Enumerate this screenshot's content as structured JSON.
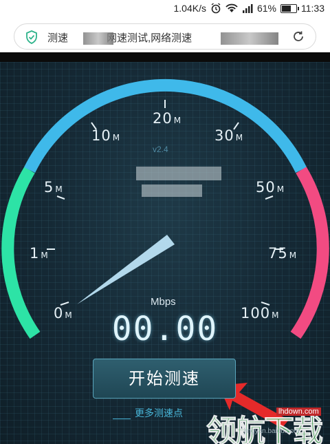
{
  "status_bar": {
    "network_speed": "1.04K/s",
    "battery_percent": "61%",
    "battery_level": 0.61,
    "time": "11:33"
  },
  "browser": {
    "url_prefix": "测速",
    "url_text": "网速测试,网络测速",
    "icons": [
      "shield-check-icon",
      "reload-icon"
    ]
  },
  "speed_test": {
    "version": "v2.4",
    "tick_labels": [
      {
        "value": "0",
        "unit": "M"
      },
      {
        "value": "1",
        "unit": "M"
      },
      {
        "value": "5",
        "unit": "M"
      },
      {
        "value": "10",
        "unit": "M"
      },
      {
        "value": "20",
        "unit": "M"
      },
      {
        "value": "30",
        "unit": "M"
      },
      {
        "value": "50",
        "unit": "M"
      },
      {
        "value": "75",
        "unit": "M"
      },
      {
        "value": "100",
        "unit": "M"
      }
    ],
    "unit_label": "Mbps",
    "speed_value": "00.00",
    "start_button_label": "开始测速",
    "more_points_label": "更多测速点",
    "colors": {
      "arc_low": "#2de3a6",
      "arc_mid": "#3fb9ea",
      "arc_high": "#f24b82",
      "needle": "#bfe6fa",
      "arrow": "#e52a2a"
    }
  },
  "watermark": {
    "site": "lhdown.com",
    "text": "领航下载",
    "sub": "jingyan.baidu.com"
  }
}
